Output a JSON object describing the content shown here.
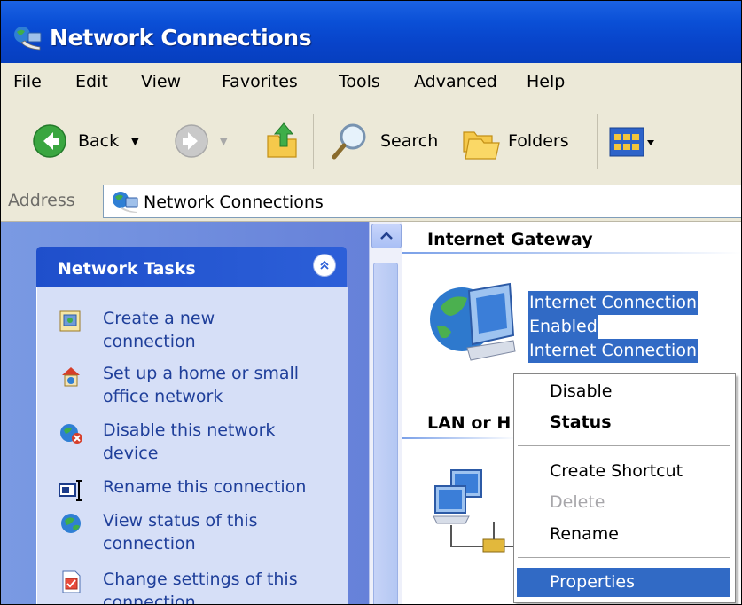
{
  "window": {
    "title": "Network Connections"
  },
  "menu": {
    "items": [
      "File",
      "Edit",
      "View",
      "Favorites",
      "Tools",
      "Advanced",
      "Help"
    ]
  },
  "toolbar": {
    "back_label": "Back",
    "search_label": "Search",
    "folders_label": "Folders"
  },
  "address": {
    "label": "Address",
    "value": "Network Connections"
  },
  "tasks": {
    "title": "Network Tasks",
    "items": [
      {
        "icon": "new-connection-icon",
        "line1": "Create a new",
        "line2": "connection"
      },
      {
        "icon": "home-network-icon",
        "line1": "Set up a home or small",
        "line2": "office network"
      },
      {
        "icon": "disable-device-icon",
        "line1": "Disable this network",
        "line2": "device"
      },
      {
        "icon": "rename-icon",
        "line1": "Rename this connection",
        "line2": ""
      },
      {
        "icon": "view-status-icon",
        "line1": "View status of this",
        "line2": "connection"
      },
      {
        "icon": "change-settings-icon",
        "line1": "Change settings of this",
        "line2": "connection"
      }
    ]
  },
  "main": {
    "group1_title": "Internet Gateway",
    "group2_title": "LAN or H",
    "connection": {
      "name": "Internet Connection",
      "status": "Enabled",
      "type": "Internet Connection"
    }
  },
  "context_menu": {
    "items": [
      "Disable",
      "Status",
      "Create Shortcut",
      "Delete",
      "Rename",
      "Properties"
    ],
    "default_item": "Status",
    "disabled_item": "Delete",
    "highlighted_item": "Properties"
  },
  "colors": {
    "titlebar": "#0a4fd6",
    "selection": "#316ac5",
    "task_link": "#1f3f9a",
    "task_pane": "#7a9ae3"
  }
}
